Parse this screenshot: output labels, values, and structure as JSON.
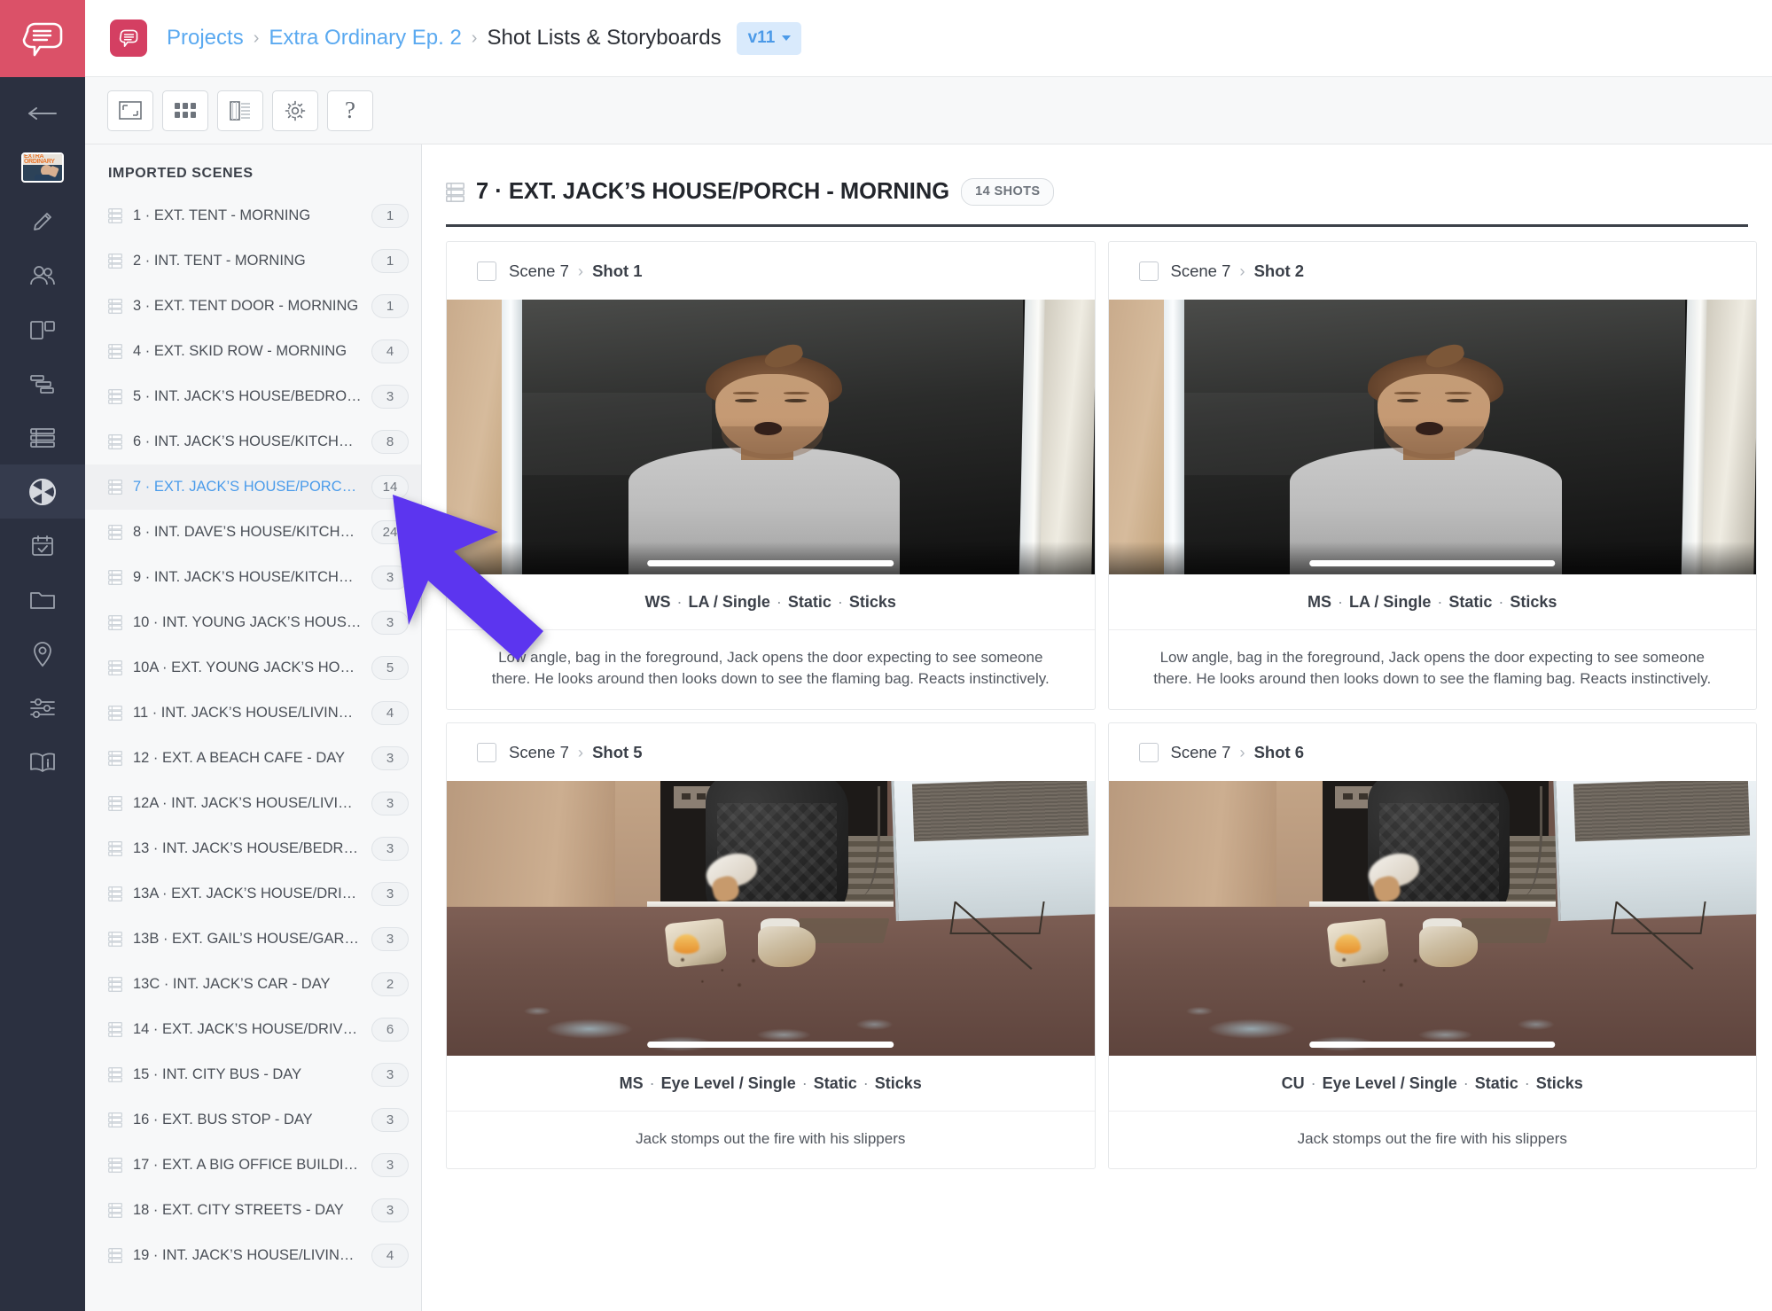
{
  "rail": {
    "logo_icon": "speech-bubble-logo",
    "back_icon": "back-arrow-icon",
    "project_thumb_title": "EXTRA ORDINARY",
    "items": [
      {
        "icon": "pencil-icon",
        "name": "script"
      },
      {
        "icon": "people-icon",
        "name": "cast"
      },
      {
        "icon": "panels-icon",
        "name": "breakdown"
      },
      {
        "icon": "gantt-icon",
        "name": "schedule"
      },
      {
        "icon": "list-rows-icon",
        "name": "shot-list"
      },
      {
        "icon": "camera-shutter-icon",
        "name": "storyboards"
      },
      {
        "icon": "calendar-check-icon",
        "name": "calendar"
      },
      {
        "icon": "folder-icon",
        "name": "files"
      },
      {
        "icon": "map-pin-icon",
        "name": "locations"
      },
      {
        "icon": "sliders-icon",
        "name": "settings"
      },
      {
        "icon": "open-book-icon",
        "name": "help-guide"
      }
    ],
    "active_index": 5
  },
  "topbar": {
    "app_badge_icon": "speech-bubble-icon",
    "breadcrumbs": [
      {
        "label": "Projects",
        "current": false
      },
      {
        "label": "Extra Ordinary Ep. 2",
        "current": false
      },
      {
        "label": "Shot Lists & Storyboards",
        "current": true
      }
    ],
    "separator": "›",
    "version": "v11"
  },
  "toolbar": {
    "buttons": [
      {
        "icon": "frame-icon",
        "name": "single-view-button"
      },
      {
        "icon": "grid-icon",
        "name": "grid-view-button"
      },
      {
        "icon": "list-panel-icon",
        "name": "list-view-button"
      },
      {
        "icon": "gear-icon",
        "name": "settings-button"
      },
      {
        "icon": "question-mark-icon",
        "name": "help-button",
        "glyph": "?"
      }
    ]
  },
  "sidebar": {
    "title": "IMPORTED SCENES",
    "scenes": [
      {
        "label": "1 · EXT. TENT - MORNING",
        "count": "1"
      },
      {
        "label": "2 · INT. TENT - MORNING",
        "count": "1"
      },
      {
        "label": "3 · EXT. TENT DOOR - MORNING",
        "count": "1"
      },
      {
        "label": "4 · EXT. SKID ROW - MORNING",
        "count": "4"
      },
      {
        "label": "5 · INT. JACK’S HOUSE/BEDRO…",
        "count": "3"
      },
      {
        "label": "6 · INT. JACK’S HOUSE/KITCHE…",
        "count": "8"
      },
      {
        "label": "7 · EXT. JACK’S HOUSE/PORC…",
        "count": "14",
        "selected": true
      },
      {
        "label": "8 · INT. DAVE’S HOUSE/KITCHE…",
        "count": "24"
      },
      {
        "label": "9 · INT. JACK’S HOUSE/KITCHE…",
        "count": "3"
      },
      {
        "label": "10 · INT. YOUNG JACK’S HOUS…",
        "count": "3"
      },
      {
        "label": "10A · EXT. YOUNG JACK’S HOU…",
        "count": "5"
      },
      {
        "label": "11 · INT. JACK’S HOUSE/LIVING…",
        "count": "4"
      },
      {
        "label": "12 · EXT. A BEACH CAFE - DAY",
        "count": "3"
      },
      {
        "label": "12A · INT. JACK’S HOUSE/LIVIN…",
        "count": "3"
      },
      {
        "label": "13 · INT. JACK’S HOUSE/BEDR…",
        "count": "3"
      },
      {
        "label": "13A · EXT. JACK’S HOUSE/DRIV…",
        "count": "3"
      },
      {
        "label": "13B · EXT. GAIL’S HOUSE/GAR…",
        "count": "3"
      },
      {
        "label": "13C · INT. JACK’S CAR - DAY",
        "count": "2"
      },
      {
        "label": "14 · EXT. JACK’S HOUSE/DRIVE…",
        "count": "6"
      },
      {
        "label": "15 · INT. CITY BUS - DAY",
        "count": "3"
      },
      {
        "label": "16 · EXT. BUS STOP - DAY",
        "count": "3"
      },
      {
        "label": "17 · EXT. A BIG OFFICE BUILDI…",
        "count": "3"
      },
      {
        "label": "18 · EXT. CITY STREETS - DAY",
        "count": "3"
      },
      {
        "label": "19 · INT. JACK’S HOUSE/LIVING…",
        "count": "4"
      }
    ]
  },
  "panel": {
    "header_icon": "list-rows-icon",
    "title": "7 · EXT. JACK’S HOUSE/PORCH - MORNING",
    "shots_badge": "14 SHOTS",
    "shots": [
      {
        "scene_label": "Scene 7",
        "separator": "›",
        "shot_label": "Shot 1",
        "still": "man-in-doorway-reacting",
        "meta": [
          "WS",
          "LA / Single",
          "Static",
          "Sticks"
        ],
        "description": "Low angle, bag in the foreground, Jack opens the door expecting to see someone there. He looks around then looks down to see the flaming bag. Reacts instinctively."
      },
      {
        "scene_label": "Scene 7",
        "separator": "›",
        "shot_label": "Shot 2",
        "still": "man-in-doorway-reacting",
        "meta": [
          "MS",
          "LA / Single",
          "Static",
          "Sticks"
        ],
        "description": "Low angle, bag in the foreground, Jack opens the door expecting to see someone there. He looks around then looks down to see the flaming bag. Reacts instinctively."
      },
      {
        "scene_label": "Scene 7",
        "separator": "›",
        "shot_label": "Shot 5",
        "still": "legs-stomping-burning-bag",
        "meta": [
          "MS",
          "Eye Level / Single",
          "Static",
          "Sticks"
        ],
        "description": "Jack stomps out the fire with his slippers"
      },
      {
        "scene_label": "Scene 7",
        "separator": "›",
        "shot_label": "Shot 6",
        "still": "legs-stomping-burning-bag",
        "meta": [
          "CU",
          "Eye Level / Single",
          "Static",
          "Sticks"
        ],
        "description": "Jack stomps out the fire with his slippers"
      }
    ]
  },
  "annotation": {
    "arrow": "pointer-arrow",
    "color": "#5b35ef",
    "points_to": "sidebar-scene-7"
  },
  "colors": {
    "brand_red": "#db5168",
    "rail_dark": "#2b3040",
    "link_blue": "#5aa9f0",
    "accent_purple": "#5b35ef"
  }
}
